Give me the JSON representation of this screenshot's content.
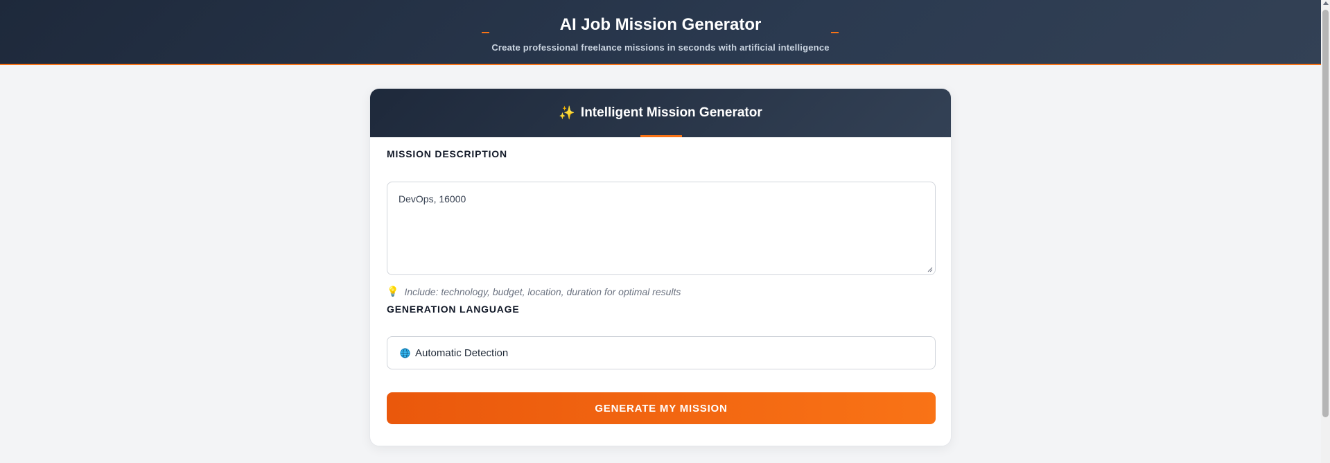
{
  "header": {
    "title": "AI Job Mission Generator",
    "subtitle": "Create professional freelance missions in seconds with artificial intelligence"
  },
  "card": {
    "icon": "sparkles-icon",
    "title": "Intelligent Mission Generator",
    "mission": {
      "label": "MISSION DESCRIPTION",
      "value": "DevOps, 16000",
      "hint_icon": "lightbulb-icon",
      "hint": "Include: technology, budget, location, duration for optimal results"
    },
    "language": {
      "label": "GENERATION LANGUAGE",
      "icon": "globe-icon",
      "selected": "Automatic Detection"
    },
    "generate_label": "GENERATE MY MISSION"
  },
  "colors": {
    "header_bg": "#1e293b",
    "accent": "#f97316",
    "button_start": "#ea580c",
    "button_end": "#f97316"
  }
}
